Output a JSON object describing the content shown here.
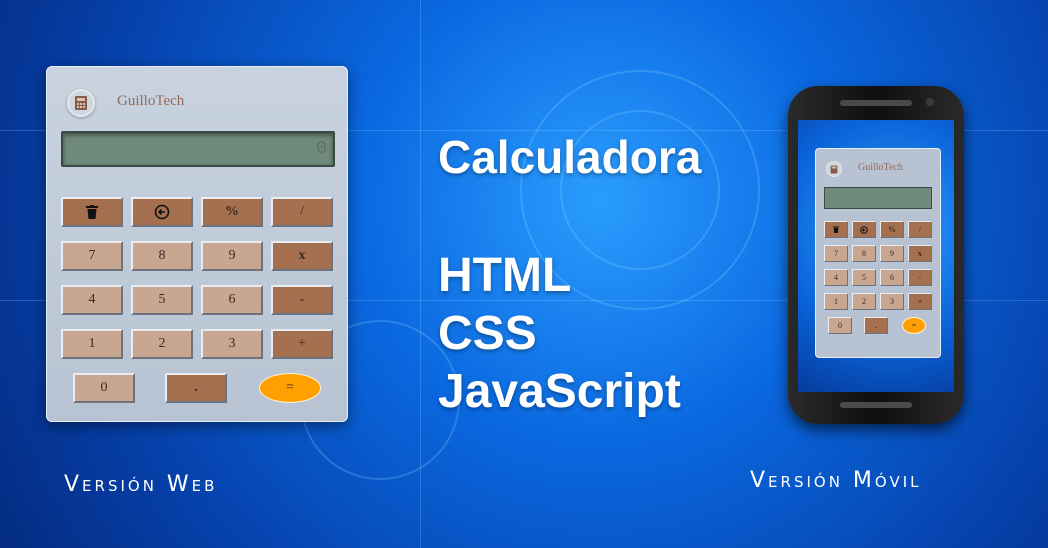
{
  "brand": "GuilloTech",
  "colors": {
    "background": "#0a68e0",
    "key_dark": "#a5704f",
    "key_light": "#c9a68f",
    "equals": "#ffa000",
    "display": "#6f8a7a"
  },
  "web_calc": {
    "display_value": "0",
    "keys": {
      "clear_icon": "trash-icon",
      "backspace_icon": "backspace-icon",
      "percent": "%",
      "divide": "/",
      "seven": "7",
      "eight": "8",
      "nine": "9",
      "multiply": "x",
      "four": "4",
      "five": "5",
      "six": "6",
      "minus": "-",
      "one": "1",
      "two": "2",
      "three": "3",
      "plus": "+",
      "zero": "0",
      "dot": ".",
      "equals": "="
    }
  },
  "headline": {
    "title": "Calculadora",
    "tech1": "HTML",
    "tech2": "CSS",
    "tech3": "JavaScript"
  },
  "captions": {
    "web": "Versión Web",
    "mobile": "Versión Móvil"
  }
}
